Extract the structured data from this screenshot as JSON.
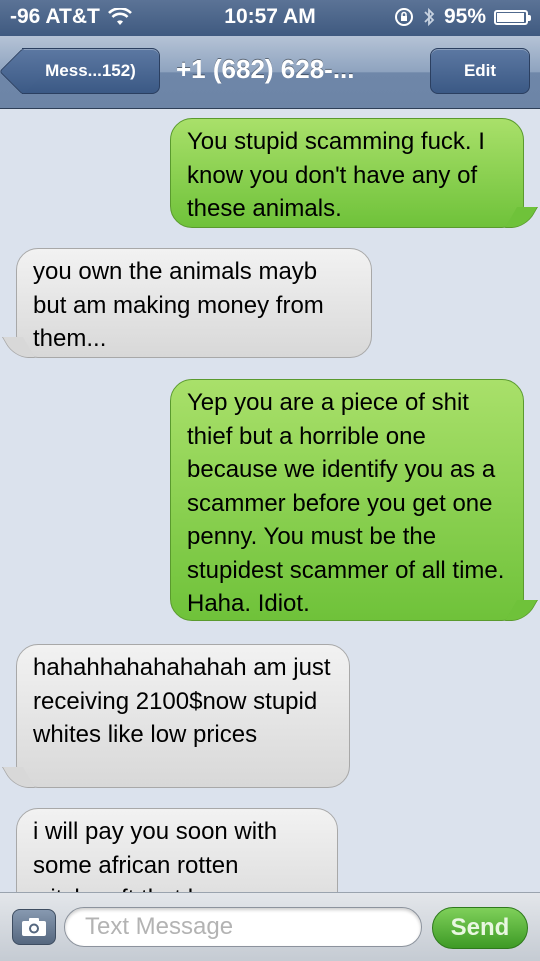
{
  "status_bar": {
    "carrier": "-96 AT&T",
    "time": "10:57 AM",
    "battery": "95%",
    "battery_level": 0.95
  },
  "nav": {
    "back_label": "Mess...152)",
    "title": "+1 (682) 628-...",
    "edit_label": "Edit"
  },
  "messages": [
    {
      "type": "sent",
      "text": "You stupid scamming fuck. I know you don't have any of these animals."
    },
    {
      "type": "received",
      "text": "you own the animals mayb but am making money from them..."
    },
    {
      "type": "sent",
      "text": "Yep you are a piece of shit thief but a horrible one because we identify you as a scammer before you get one penny. You must be the stupidest scammer of all time. Haha. Idiot."
    },
    {
      "type": "received",
      "text": "hahahhahahahahah  am just receiving 2100$now stupid whites like low prices"
    },
    {
      "type": "received",
      "text": "i will pay you soon with some african rotten witchcraft that has no"
    }
  ],
  "input": {
    "placeholder": "Text Message",
    "send_label": "Send"
  },
  "colors": {
    "sent_bubble": "#7cc943",
    "received_bubble": "#e6e6e6",
    "nav_bar": "#6f87a9",
    "background": "#dbe2ed"
  }
}
